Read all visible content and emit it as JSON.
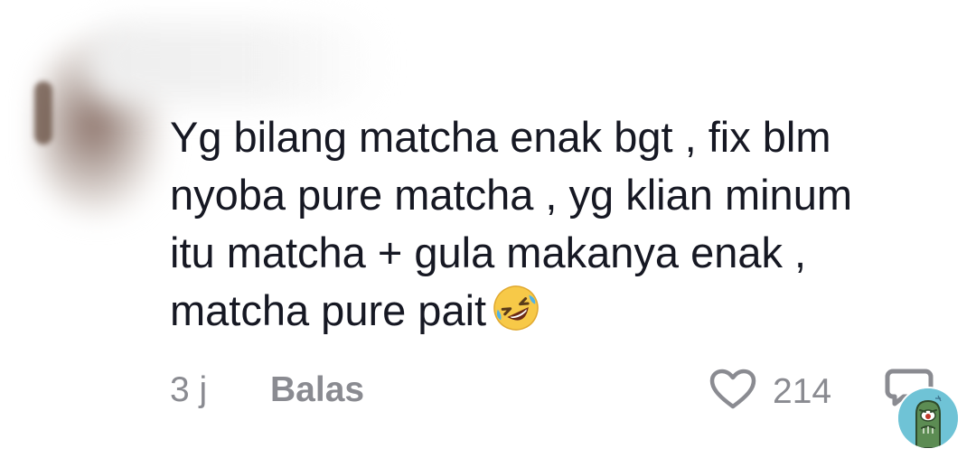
{
  "comment": {
    "lines": [
      "Yg bilang matcha enak bgt , fix blm",
      "nyoba pure matcha , yg klian minum",
      "itu matcha + gula makanya enak ,",
      "matcha pure pait"
    ],
    "emoji": "rolling-on-floor-laughing-icon"
  },
  "footer": {
    "time": "3 j",
    "reply_label": "Balas",
    "like_count": "214"
  },
  "icons": {
    "like": "heart-icon",
    "comment": "comment-bubble-icon",
    "sticker": "plankton-sticker-icon"
  },
  "colors": {
    "text": "#161823",
    "muted": "#8a8b91"
  }
}
